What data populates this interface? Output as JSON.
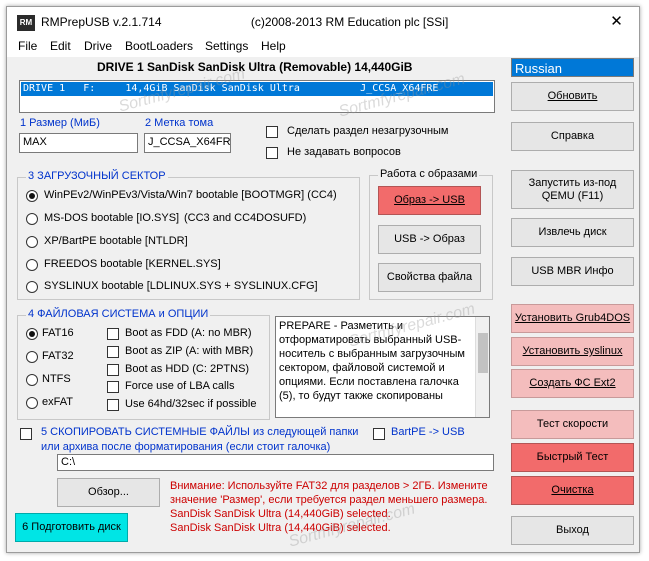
{
  "window": {
    "app_icon_text": "RM",
    "title": "RMPrepUSB v.2.1.714",
    "copyright": "(c)2008-2013 RM Education plc [SSi]",
    "close_glyph": "✕"
  },
  "menu": [
    "File",
    "Edit",
    "Drive",
    "BootLoaders",
    "Settings",
    "Help"
  ],
  "drive": {
    "header": "DRIVE 1 SanDisk SanDisk Ultra  (Removable) 14,440GiB",
    "row": "DRIVE 1   F:     14,4GiB SanDisk SanDisk Ultra          J_CCSA_X64FRE"
  },
  "language": "Russian",
  "size": {
    "label": "1 Размер (МиБ)",
    "value": "MAX"
  },
  "volume": {
    "label": "2 Метка тома",
    "value": "J_CCSA_X64FRE"
  },
  "options": {
    "nonboot": "Сделать раздел незагрузочным",
    "no_prompts": "Не задавать вопросов"
  },
  "bootsector": {
    "title": "3 ЗАГРУЗОЧНЫЙ СЕКТОР",
    "items": [
      {
        "label": "WinPEv2/WinPEv3/Vista/Win7 bootable [BOOTMGR] (CC4)",
        "extra": ""
      },
      {
        "label": "MS-DOS bootable [IO.SYS]",
        "extra": "(CC3 and CC4DOSUFD)"
      },
      {
        "label": "XP/BartPE bootable [NTLDR]",
        "extra": ""
      },
      {
        "label": "FREEDOS bootable [KERNEL.SYS]",
        "extra": ""
      },
      {
        "label": "SYSLINUX bootable [LDLINUX.SYS + SYSLINUX.CFG]",
        "extra": ""
      }
    ]
  },
  "images": {
    "title": "Работа с образами",
    "to_usb": "Образ -> USB",
    "from_usb": "USB -> Образ",
    "file_props": "Свойства файла"
  },
  "filesystem": {
    "title": "4 ФАЙЛОВАЯ СИСТЕМА и ОПЦИИ",
    "types": [
      "FAT16",
      "FAT32",
      "NTFS",
      "exFAT"
    ],
    "opts": [
      "Boot as FDD (A: no MBR)",
      "Boot as ZIP (A: with MBR)",
      "Boot as HDD (C: 2PTNS)",
      "Force use of LBA calls",
      "Use 64hd/32sec if possible"
    ]
  },
  "info_text": "PREPARE - Разметить и отформатировать выбранный USB-носитель с выбранным загрузочным сектором, файловой системой и опциями. Если поставлена галочка (5), то будут также скопированы",
  "copy": {
    "line1": "5 СКОПИРОВАТЬ СИСТЕМНЫЕ ФАЙЛЫ из следующей папки",
    "line2": "или архива после форматирования (если стоит галочка)",
    "bartpe": "BartPE -> USB",
    "path": "C:\\"
  },
  "browse": "Обзор...",
  "prepare": "6 Подготовить диск",
  "status": {
    "warning": "Внимание: Используйте FAT32 для разделов > 2ГБ. Измените значение 'Размер', если требуется раздел меньшего размера.",
    "line1": "SanDisk SanDisk Ultra (14,440GiB) selected.",
    "line2": "SanDisk SanDisk Ultra (14,440GiB) selected."
  },
  "right_buttons": {
    "refresh": "Обновить",
    "help": "Справка",
    "qemu": "Запустить из-под QEMU (F11)",
    "eject": "Извлечь диск",
    "mbr_info": "USB MBR Инфо",
    "grub4dos": "Установить Grub4DOS",
    "syslinux": "Установить syslinux",
    "ext2": "Создать ФС Ext2",
    "speed": "Тест скорости",
    "quick": "Быстрый Тест",
    "clean": "Очистка",
    "exit": "Выход"
  },
  "colors": {
    "accent": "#0078d7",
    "pink": "#f4bdbd",
    "red": "#f26b6b",
    "cyan": "#00e5e5",
    "warning": "#cc0000"
  },
  "watermark": "Sortmfyrepair.com"
}
